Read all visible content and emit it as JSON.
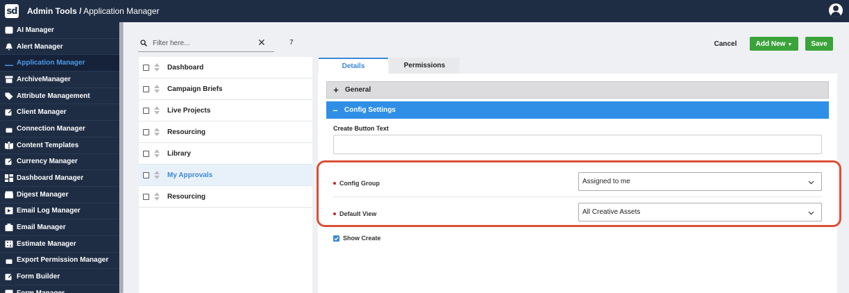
{
  "header": {
    "app_section": "Admin Tools /",
    "page": "Application Manager"
  },
  "sidebar": {
    "items": [
      {
        "label": "AI Manager",
        "icon": "ai-icon"
      },
      {
        "label": "Alert Manager",
        "icon": "bell-icon"
      },
      {
        "label": "Application Manager",
        "icon": "laptop-icon",
        "active": true
      },
      {
        "label": "ArchiveManager",
        "icon": "archive-icon"
      },
      {
        "label": "Attribute Management",
        "icon": "tag-icon"
      },
      {
        "label": "Client Manager",
        "icon": "edit-icon"
      },
      {
        "label": "Connection Manager",
        "icon": "lock-icon"
      },
      {
        "label": "Content Templates",
        "icon": "book-icon"
      },
      {
        "label": "Currency Manager",
        "icon": "edit-icon"
      },
      {
        "label": "Dashboard Manager",
        "icon": "dashboard-icon"
      },
      {
        "label": "Digest Manager",
        "icon": "inbox-icon"
      },
      {
        "label": "Email Log Manager",
        "icon": "mail-log-icon"
      },
      {
        "label": "Email Manager",
        "icon": "mail-icon"
      },
      {
        "label": "Estimate Manager",
        "icon": "calculator-icon"
      },
      {
        "label": "Export Permission Manager",
        "icon": "lock-icon"
      },
      {
        "label": "Form Builder",
        "icon": "edit-icon"
      },
      {
        "label": "Form Manager",
        "icon": "form-icon"
      }
    ]
  },
  "filter": {
    "placeholder": "Filter here...",
    "count": "7"
  },
  "list": {
    "items": [
      {
        "label": "Dashboard"
      },
      {
        "label": "Campaign Briefs"
      },
      {
        "label": "Live Projects"
      },
      {
        "label": "Resourcing"
      },
      {
        "label": "Library"
      },
      {
        "label": "My Approvals",
        "selected": true
      },
      {
        "label": "Resourcing"
      }
    ]
  },
  "toolbar": {
    "cancel_label": "Cancel",
    "add_new_label": "Add New",
    "save_label": "Save"
  },
  "tabs": {
    "details": "Details",
    "permissions": "Permissions"
  },
  "sections": {
    "general": "General",
    "config_settings": "Config Settings"
  },
  "form": {
    "create_button_text_label": "Create Button Text",
    "create_button_text_value": "",
    "config_group_label": "Config Group",
    "config_group_value": "Assigned to me",
    "default_view_label": "Default View",
    "default_view_value": "All Creative Assets",
    "show_create_label": "Show Create",
    "show_create_checked": true
  },
  "colors": {
    "topbar": "#1f2d44",
    "accent": "#3b88d8",
    "button_green": "#3aa33a",
    "highlight": "#d94f37"
  }
}
